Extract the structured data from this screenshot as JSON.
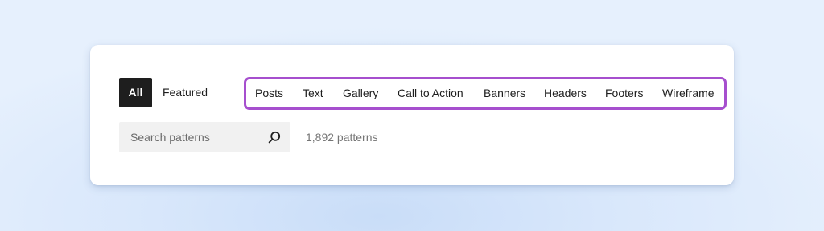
{
  "tabs": {
    "all": "All",
    "featured": "Featured",
    "categories": [
      "Posts",
      "Text",
      "Gallery",
      "Call to Action",
      "Banners",
      "Headers",
      "Footers",
      "Wireframe"
    ]
  },
  "search": {
    "placeholder": "Search patterns",
    "value": "",
    "icon": "search-icon"
  },
  "results": {
    "count_label": "1,892 patterns"
  },
  "colors": {
    "highlight": "#a64fce",
    "active_tab_bg": "#1e1e1e",
    "search_bg": "#f1f1f1"
  }
}
